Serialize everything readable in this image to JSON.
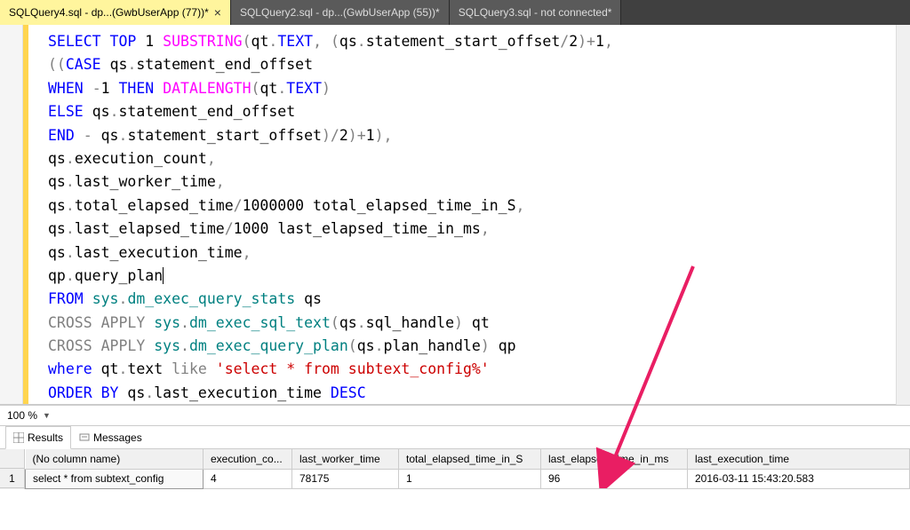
{
  "tabs": [
    {
      "label": "SQLQuery4.sql - dp...(GwbUserApp (77))*",
      "active": true,
      "closable": true
    },
    {
      "label": "SQLQuery2.sql - dp...(GwbUserApp (55))*",
      "active": false,
      "closable": false
    },
    {
      "label": "SQLQuery3.sql - not connected*",
      "active": false,
      "closable": false
    }
  ],
  "zoom": {
    "value": "100 %"
  },
  "panels": {
    "results_label": "Results",
    "messages_label": "Messages"
  },
  "results": {
    "columns": [
      "(No column name)",
      "execution_co...",
      "last_worker_time",
      "total_elapsed_time_in_S",
      "last_elapsed_time_in_ms",
      "last_execution_time"
    ],
    "rownum": "1",
    "row": [
      "select * from subtext_config",
      "4",
      "78175",
      "1",
      "96",
      "2016-03-11 15:43:20.583"
    ]
  },
  "sql": {
    "l1": {
      "a": "SELECT",
      "b": "TOP",
      "c": "1",
      "d": "SUBSTRING",
      "e": "qt",
      "f": "TEXT",
      "g": "qs",
      "h": "statement_start_offset",
      "i": "2",
      "j": "1"
    },
    "l2": {
      "a": "CASE",
      "b": "qs",
      "c": "statement_end_offset"
    },
    "l3": {
      "a": "WHEN",
      "b": "-",
      "c": "1",
      "d": "THEN",
      "e": "DATALENGTH",
      "f": "qt",
      "g": "TEXT"
    },
    "l4": {
      "a": "ELSE",
      "b": "qs",
      "c": "statement_end_offset"
    },
    "l5": {
      "a": "END",
      "b": "-",
      "c": "qs",
      "d": "statement_start_offset",
      "e": "2",
      "f": "1"
    },
    "l6": {
      "a": "qs",
      "b": "execution_count"
    },
    "l7": {
      "a": "qs",
      "b": "last_worker_time"
    },
    "l8": {
      "a": "qs",
      "b": "total_elapsed_time",
      "c": "1000000",
      "d": "total_elapsed_time_in_S"
    },
    "l9": {
      "a": "qs",
      "b": "last_elapsed_time",
      "c": "1000",
      "d": "last_elapsed_time_in_ms"
    },
    "l10": {
      "a": "qs",
      "b": "last_execution_time"
    },
    "l11": {
      "a": "qp",
      "b": "query_plan"
    },
    "l12": {
      "a": "FROM",
      "b": "sys",
      "c": "dm_exec_query_stats",
      "d": "qs"
    },
    "l13": {
      "a": "CROSS",
      "b": "APPLY",
      "c": "sys",
      "d": "dm_exec_sql_text",
      "e": "qs",
      "f": "sql_handle",
      "g": "qt"
    },
    "l14": {
      "a": "CROSS",
      "b": "APPLY",
      "c": "sys",
      "d": "dm_exec_query_plan",
      "e": "qs",
      "f": "plan_handle",
      "g": "qp"
    },
    "l15": {
      "a": "where",
      "b": "qt",
      "c": "text",
      "d": "like",
      "e": "'select * from subtext_config%'"
    },
    "l16": {
      "a": "ORDER",
      "b": "BY",
      "c": "qs",
      "d": "last_execution_time",
      "e": "DESC"
    }
  }
}
